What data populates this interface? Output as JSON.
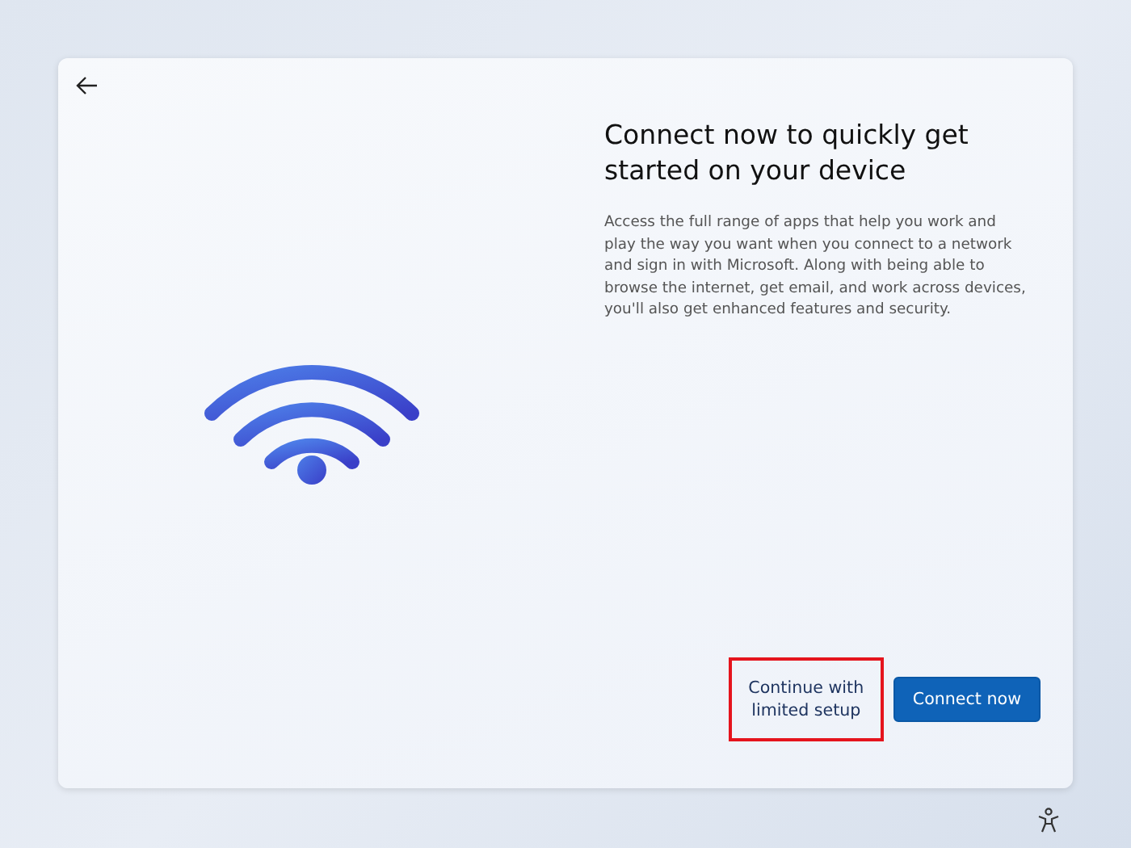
{
  "title": "Connect now to quickly get started on your device",
  "description": "Access the full range of apps that help you work and play the way you want when you connect to a network and sign in with Microsoft. Along with being able to browse the internet, get email, and work across devices, you'll also get enhanced features and security.",
  "buttons": [
    {
      "label": "Continue with limited setup",
      "kind": "secondary",
      "highlighted": true
    },
    {
      "label": "Connect now",
      "kind": "primary",
      "highlighted": false
    }
  ]
}
